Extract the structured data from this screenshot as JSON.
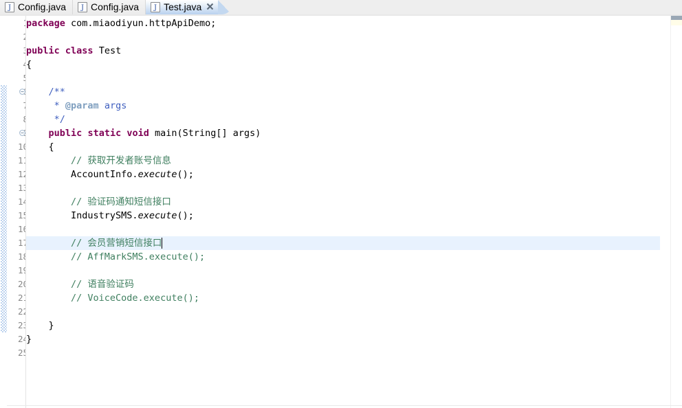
{
  "window": {
    "app": "Eclipse Java Editor"
  },
  "tabs": [
    {
      "label": "Config.java",
      "icon": "java-file-icon",
      "active": false,
      "closable": false
    },
    {
      "label": "Config.java",
      "icon": "java-file-icon",
      "active": false,
      "closable": false
    },
    {
      "label": "Test.java",
      "icon": "java-file-icon",
      "active": true,
      "closable": true,
      "close_icon": "close-icon"
    }
  ],
  "editor": {
    "file": "Test.java",
    "current_line": 17,
    "caret": {
      "line": 17,
      "column": 21
    },
    "total_visible_lines": 25,
    "gutter": {
      "fold_markers": [
        6,
        9
      ],
      "fold_icon": "collapse-minus-icon",
      "range_indicator_start_line": 6,
      "range_indicator_end_line": 23
    },
    "colors": {
      "keyword": "#7F0055",
      "comment": "#3F7F5F",
      "javadoc": "#3F5FBF",
      "javadoc_tag": "#7F9FBF",
      "text": "#000000",
      "line_number": "#888888",
      "current_line_highlight": "#E8F2FE",
      "range_indicator": "#BCD2EE"
    },
    "lines": [
      {
        "n": 1,
        "tokens": [
          {
            "t": "package",
            "c": "kw"
          },
          {
            "t": " com.miaodiyun.httpApiDemo;",
            "c": "plain"
          }
        ]
      },
      {
        "n": 2,
        "tokens": []
      },
      {
        "n": 3,
        "tokens": [
          {
            "t": "public",
            "c": "kw"
          },
          {
            "t": " ",
            "c": "plain"
          },
          {
            "t": "class",
            "c": "kw"
          },
          {
            "t": " Test",
            "c": "plain"
          }
        ]
      },
      {
        "n": 4,
        "tokens": [
          {
            "t": "{",
            "c": "plain"
          }
        ]
      },
      {
        "n": 5,
        "tokens": []
      },
      {
        "n": 6,
        "tokens": [
          {
            "t": "    /**",
            "c": "doc"
          }
        ]
      },
      {
        "n": 7,
        "tokens": [
          {
            "t": "     * ",
            "c": "doc"
          },
          {
            "t": "@param",
            "c": "doctag"
          },
          {
            "t": " args",
            "c": "doc"
          }
        ]
      },
      {
        "n": 8,
        "tokens": [
          {
            "t": "     */",
            "c": "doc"
          }
        ]
      },
      {
        "n": 9,
        "tokens": [
          {
            "t": "    ",
            "c": "plain"
          },
          {
            "t": "public",
            "c": "kw"
          },
          {
            "t": " ",
            "c": "plain"
          },
          {
            "t": "static",
            "c": "kw"
          },
          {
            "t": " ",
            "c": "plain"
          },
          {
            "t": "void",
            "c": "kw"
          },
          {
            "t": " main(String[] args)",
            "c": "plain"
          }
        ]
      },
      {
        "n": 10,
        "tokens": [
          {
            "t": "    {",
            "c": "plain"
          }
        ]
      },
      {
        "n": 11,
        "tokens": [
          {
            "t": "        // 获取开发者账号信息",
            "c": "cmt"
          }
        ]
      },
      {
        "n": 12,
        "tokens": [
          {
            "t": "        AccountInfo.",
            "c": "plain"
          },
          {
            "t": "execute",
            "c": "stat"
          },
          {
            "t": "();",
            "c": "plain"
          }
        ]
      },
      {
        "n": 13,
        "tokens": []
      },
      {
        "n": 14,
        "tokens": [
          {
            "t": "        // 验证码通知短信接口",
            "c": "cmt"
          }
        ]
      },
      {
        "n": 15,
        "tokens": [
          {
            "t": "        IndustrySMS.",
            "c": "plain"
          },
          {
            "t": "execute",
            "c": "stat"
          },
          {
            "t": "();",
            "c": "plain"
          }
        ]
      },
      {
        "n": 16,
        "tokens": []
      },
      {
        "n": 17,
        "tokens": [
          {
            "t": "        // 会员营销短信接口",
            "c": "cmt"
          }
        ]
      },
      {
        "n": 18,
        "tokens": [
          {
            "t": "        // AffMarkSMS.execute();",
            "c": "cmt"
          }
        ]
      },
      {
        "n": 19,
        "tokens": []
      },
      {
        "n": 20,
        "tokens": [
          {
            "t": "        // 语音验证码",
            "c": "cmt"
          }
        ]
      },
      {
        "n": 21,
        "tokens": [
          {
            "t": "        // VoiceCode.execute();",
            "c": "cmt"
          }
        ]
      },
      {
        "n": 22,
        "tokens": []
      },
      {
        "n": 23,
        "tokens": [
          {
            "t": "    }",
            "c": "plain"
          }
        ]
      },
      {
        "n": 24,
        "tokens": [
          {
            "t": "}",
            "c": "plain"
          }
        ]
      },
      {
        "n": 25,
        "tokens": []
      }
    ]
  }
}
